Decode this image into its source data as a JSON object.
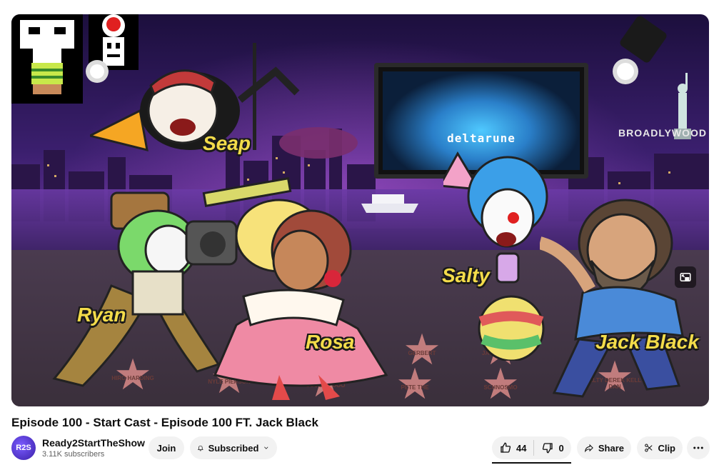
{
  "video": {
    "labels": {
      "seap": "Seap",
      "ryan": "Ryan",
      "rosa": "Rosa",
      "salty": "Salty",
      "jack": "Jack Black"
    },
    "screen_text": "deltarune",
    "sign_text": "BROADLYWOOD",
    "stars": [
      "HIRO HARDING",
      "NYLE PIERSON",
      "SCOOBY DOO",
      "PETE THE",
      "SCHNOSMO",
      "GERBERT",
      "JACK BLACK",
      "SALTY DEREK KELLY DAN"
    ]
  },
  "title": "Episode 100 - Start Cast - Episode 100 FT. Jack Black",
  "channel": {
    "name": "Ready2StartTheShow",
    "subscribers": "3.11K subscribers",
    "avatar_text": "R2S"
  },
  "actions": {
    "join_label": "Join",
    "subscribed_label": "Subscribed",
    "like_count": "44",
    "dislike_count": "0",
    "share_label": "Share",
    "clip_label": "Clip"
  },
  "icons": {
    "bell": "bell-icon",
    "chevron": "chevron-down-icon",
    "like": "thumbs-up-icon",
    "dislike": "thumbs-down-icon",
    "share": "share-arrow-icon",
    "clip": "scissors-icon",
    "more": "more-horizontal-icon",
    "expand": "miniplayer-icon"
  }
}
